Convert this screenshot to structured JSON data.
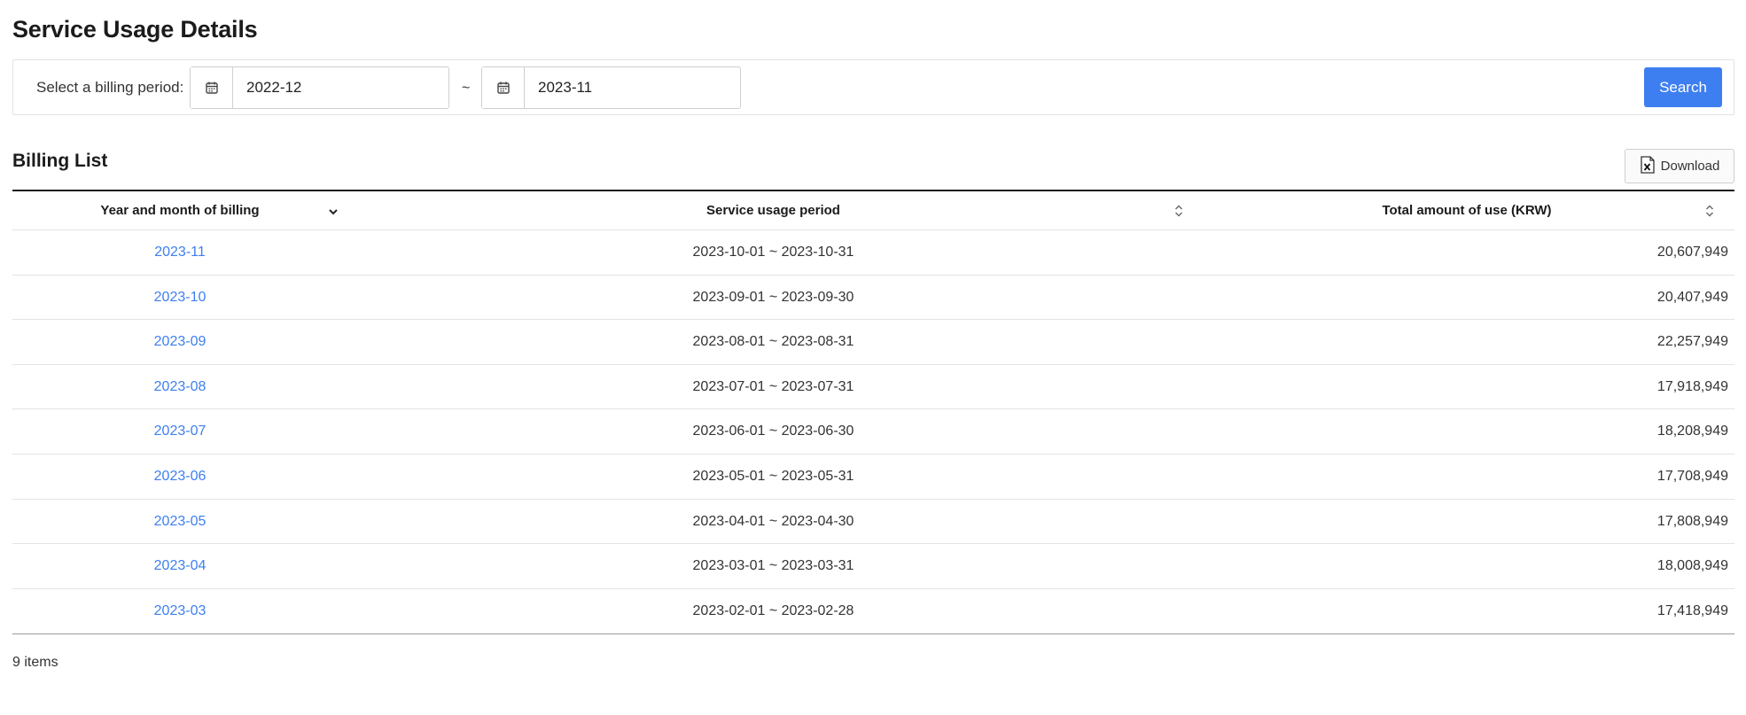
{
  "page": {
    "title": "Service Usage Details"
  },
  "filter": {
    "label": "Select a billing period:",
    "from_value": "2022-12",
    "separator": "~",
    "to_value": "2023-11",
    "search_label": "Search",
    "icons": [
      "calendar-icon",
      "calendar-icon"
    ]
  },
  "list": {
    "title": "Billing List",
    "download_label": "Download",
    "download_icon": "excel-file-icon",
    "columns": [
      "Year and month of billing",
      "Service usage period",
      "Total amount of use (KRW)"
    ],
    "sort_icons": [
      "chevron-down-icon",
      "sort-up-down-icon",
      "sort-up-down-icon"
    ],
    "rows": [
      {
        "month": "2023-11",
        "period": "2023-10-01 ~ 2023-10-31",
        "amount": "20,607,949"
      },
      {
        "month": "2023-10",
        "period": "2023-09-01 ~ 2023-09-30",
        "amount": "20,407,949"
      },
      {
        "month": "2023-09",
        "period": "2023-08-01 ~ 2023-08-31",
        "amount": "22,257,949"
      },
      {
        "month": "2023-08",
        "period": "2023-07-01 ~ 2023-07-31",
        "amount": "17,918,949"
      },
      {
        "month": "2023-07",
        "period": "2023-06-01 ~ 2023-06-30",
        "amount": "18,208,949"
      },
      {
        "month": "2023-06",
        "period": "2023-05-01 ~ 2023-05-31",
        "amount": "17,708,949"
      },
      {
        "month": "2023-05",
        "period": "2023-04-01 ~ 2023-04-30",
        "amount": "17,808,949"
      },
      {
        "month": "2023-04",
        "period": "2023-03-01 ~ 2023-03-31",
        "amount": "18,008,949"
      },
      {
        "month": "2023-03",
        "period": "2023-02-01 ~ 2023-02-28",
        "amount": "17,418,949"
      }
    ],
    "count_text": "9 items"
  },
  "colors": {
    "accent": "#3d7ff0",
    "link": "#3d7ff0",
    "header_rule": "#1b1b1b"
  }
}
